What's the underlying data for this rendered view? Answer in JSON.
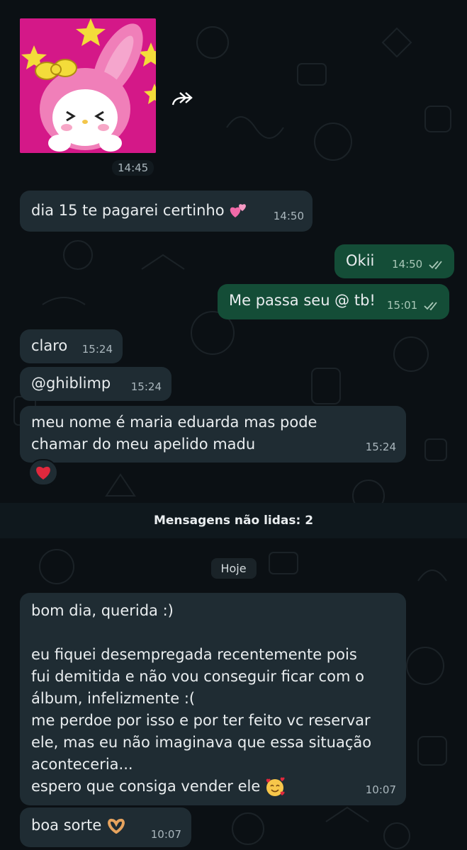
{
  "image_message": {
    "time": "14:45"
  },
  "messages": [
    {
      "text": "dia 15 te pagarei certinho",
      "emoji": "two-hearts",
      "time": "14:50",
      "direction": "incoming"
    },
    {
      "text": "Okii",
      "time": "14:50",
      "direction": "outgoing",
      "status": "read"
    },
    {
      "text": "Me passa seu @ tb!",
      "time": "15:01",
      "direction": "outgoing",
      "status": "read"
    },
    {
      "text": "claro",
      "time": "15:24",
      "direction": "incoming"
    },
    {
      "text": "@ghiblimp",
      "time": "15:24",
      "direction": "incoming"
    },
    {
      "lines": [
        "meu nome é maria eduarda mas pode",
        "chamar do meu apelido madu"
      ],
      "time": "15:24",
      "direction": "incoming",
      "reaction": "red-heart"
    },
    {
      "lines": [
        "bom dia, querida :)",
        "",
        "eu fiquei desempregada recentemente pois",
        "fui demitida e não vou conseguir ficar com o",
        "álbum, infelizmente :(",
        "me perdoe por isso e por ter feito vc reservar",
        "ele, mas eu não imaginava que essa situação",
        "aconteceria...",
        "espero que consiga vender ele"
      ],
      "emoji": "smiling-face-with-hearts",
      "time": "10:07",
      "direction": "incoming"
    },
    {
      "text": "boa sorte",
      "emoji": "heart-hands",
      "time": "10:07",
      "direction": "incoming"
    }
  ],
  "unread_banner": "Mensagens não lidas: 2",
  "date_separator": "Hoje",
  "colors": {
    "background": "#0b1014",
    "incoming": "#1f2c33",
    "outgoing": "#144d37",
    "read_ticks": "#a9c8b8",
    "sticker_bg": "#d41888"
  }
}
